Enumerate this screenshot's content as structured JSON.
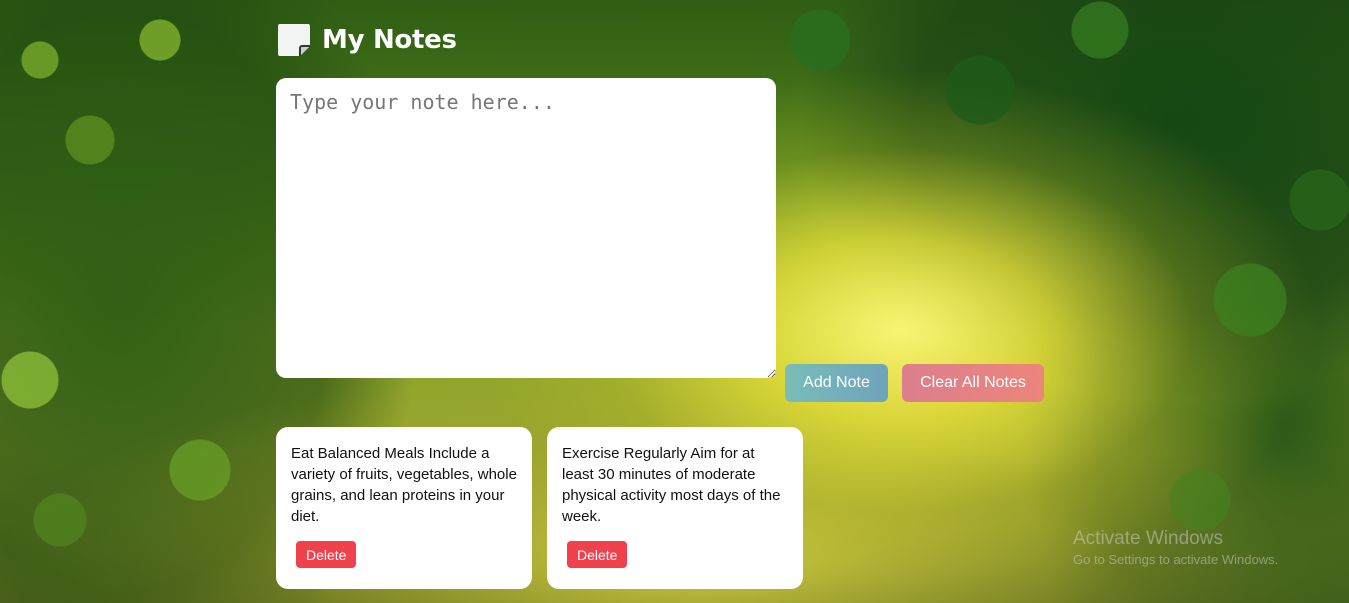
{
  "app": {
    "title": "My Notes",
    "icon": "sticky-note-icon"
  },
  "editor": {
    "placeholder": "Type your note here...",
    "value": ""
  },
  "buttons": {
    "add_label": "Add Note",
    "clear_label": "Clear All Notes",
    "add_gradient": [
      "#79bdb9",
      "#6fa3bb"
    ],
    "clear_gradient": [
      "#dc7e8e",
      "#ec857a"
    ]
  },
  "notes": [
    {
      "text": "Eat Balanced Meals Include a variety of fruits, vegetables, whole grains, and lean proteins in your diet.",
      "delete_label": "Delete"
    },
    {
      "text": "Exercise Regularly Aim for at least 30 minutes of moderate physical activity most days of the week.",
      "delete_label": "Delete"
    }
  ],
  "watermark": {
    "title": "Activate Windows",
    "subtitle": "Go to Settings to activate Windows."
  },
  "colors": {
    "delete": "#f0424d",
    "card": "#ffffff",
    "title": "#ffffff"
  }
}
